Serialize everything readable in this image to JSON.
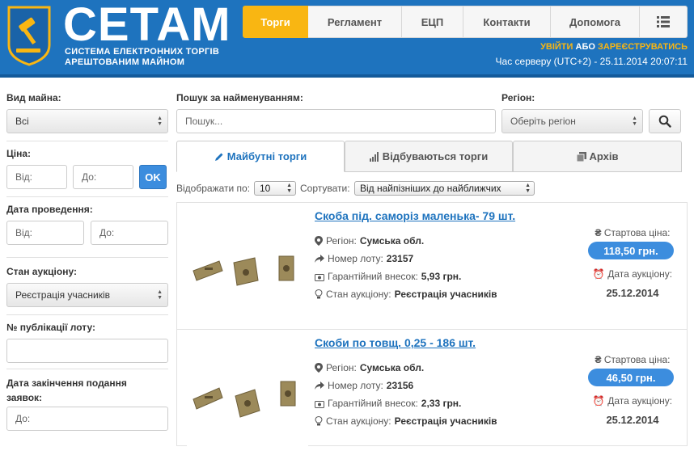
{
  "header": {
    "logo": "СЕТАМ",
    "subtitle_line1": "СИСТЕМА ЕЛЕКТРОННИХ ТОРГІВ",
    "subtitle_line2": "АРЕШТОВАНИМ МАЙНОМ",
    "nav": [
      "Торги",
      "Регламент",
      "ЕЦП",
      "Контакти",
      "Допомога"
    ],
    "login": "УВІЙТИ",
    "or": "АБО",
    "register": "ЗАРЕЄСТРУВАТИСЬ",
    "server_time": "Час серверу (UTC+2) - 25.11.2014 20:07:11"
  },
  "filters": {
    "type_label": "Вид майна:",
    "type_value": "Всі",
    "price_label": "Ціна:",
    "price_from": "Від:",
    "price_to": "До:",
    "ok": "OK",
    "date_label": "Дата проведення:",
    "date_from": "Від:",
    "date_to": "До:",
    "state_label": "Стан аукціону:",
    "state_value": "Реєстрація учасників",
    "lot_no_label": "№ публікації лоту:",
    "deadline_label_1": "Дата закінчення подання",
    "deadline_label_2": "заявок:",
    "deadline_to": "До:"
  },
  "search": {
    "label": "Пошук за найменуванням:",
    "placeholder": "Пошук...",
    "region_label": "Регіон:",
    "region_value": "Оберіть регіон"
  },
  "tabs": [
    "Майбутні торги",
    "Відбуваються торги",
    "Архів"
  ],
  "list_controls": {
    "show_label": "Відображати по:",
    "show_value": "10",
    "sort_label": "Сортувати:",
    "sort_value": "Від найпізніших до найближчих"
  },
  "lots": [
    {
      "title": "Скоба під. саморіз маленька- 79 шт.",
      "region_label": "Регіон:",
      "region": "Сумська обл.",
      "lot_label": "Номер лоту:",
      "lot": "23157",
      "deposit_label": "Гарантійний внесок:",
      "deposit": "5,93 грн.",
      "state_label": "Стан аукціону:",
      "state": "Реєстрація учасників",
      "start_price_label": "Стартова ціна:",
      "start_price": "118,50 грн.",
      "date_label": "Дата аукціону:",
      "date": "25.12.2014"
    },
    {
      "title": "Скоби по товщ. 0,25 - 186 шт.",
      "region_label": "Регіон:",
      "region": "Сумська обл.",
      "lot_label": "Номер лоту:",
      "lot": "23156",
      "deposit_label": "Гарантійний внесок:",
      "deposit": "2,33 грн.",
      "state_label": "Стан аукціону:",
      "state": "Реєстрація учасників",
      "start_price_label": "Стартова ціна:",
      "start_price": "46,50 грн.",
      "date_label": "Дата аукціону:",
      "date": "25.12.2014"
    }
  ],
  "colors": {
    "header_blue": "#1e73be",
    "accent_yellow": "#f9b612",
    "price_blue": "#3c8dde"
  }
}
